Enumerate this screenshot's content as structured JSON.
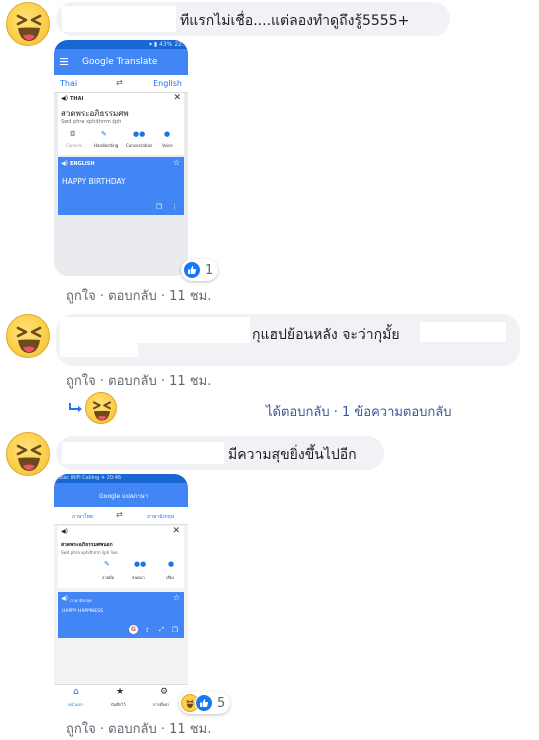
{
  "comment1": {
    "text": "ทีแรกไม่เชื่อ....แต่ลองทำดูถึงรู้5555+",
    "like": "ถูกใจ",
    "reply": "ตอบกลับ",
    "time": "11 ชม.",
    "reaction_count": "1",
    "screenshot": {
      "status": "▾ ▮ 43% 22:",
      "app_title": "Google Translate",
      "source_lang": "Thai",
      "target_lang": "English",
      "source_label": "THAI",
      "source_text": "สวดพระอภิธรรมศพ",
      "transliteration": "Swd phra xphiṭhrrm ṣ̄ph",
      "tools": [
        "Camera",
        "Handwriting",
        "Conversation",
        "Voice"
      ],
      "target_label": "ENGLISH",
      "translation": "HAPPY BIRTHDAY"
    }
  },
  "comment2": {
    "text": "กุแฮปย้อนหลัง จะว่ากุมั้ย",
    "like": "ถูกใจ",
    "reply": "ตอบกลับ",
    "time": "11 ชม.",
    "replies_link": "ได้ตอบกลับ · 1 ข้อความตอบกลับ"
  },
  "comment3": {
    "text": "มีความสุขยิ่งขึ้นไปอีก",
    "like": "ถูกใจ",
    "reply": "ตอบกลับ",
    "time": "11 ชม.",
    "reaction_count": "5",
    "screenshot": {
      "status": "dtac WiFi Calling ✈ 20:46",
      "app_title": "Google แปลภาษา",
      "source_lang": "ภาษาไทย",
      "target_lang": "ภาษาอังกฤษ",
      "source_text": "สวดพระอภิธรรมศพนอก",
      "transliteration": "Swd phra xphiṭhrrm ṣ̄ph n̂xk",
      "tools": [
        "",
        "ลายมือ",
        "สนทนา",
        "เสียง"
      ],
      "target_label": "ภาษาอังกฤษ",
      "translation": "HAPPY HAPPINESS",
      "nav": [
        "หน้าแรก",
        "บันทึกไว้",
        "การตั้งค่า"
      ]
    }
  }
}
